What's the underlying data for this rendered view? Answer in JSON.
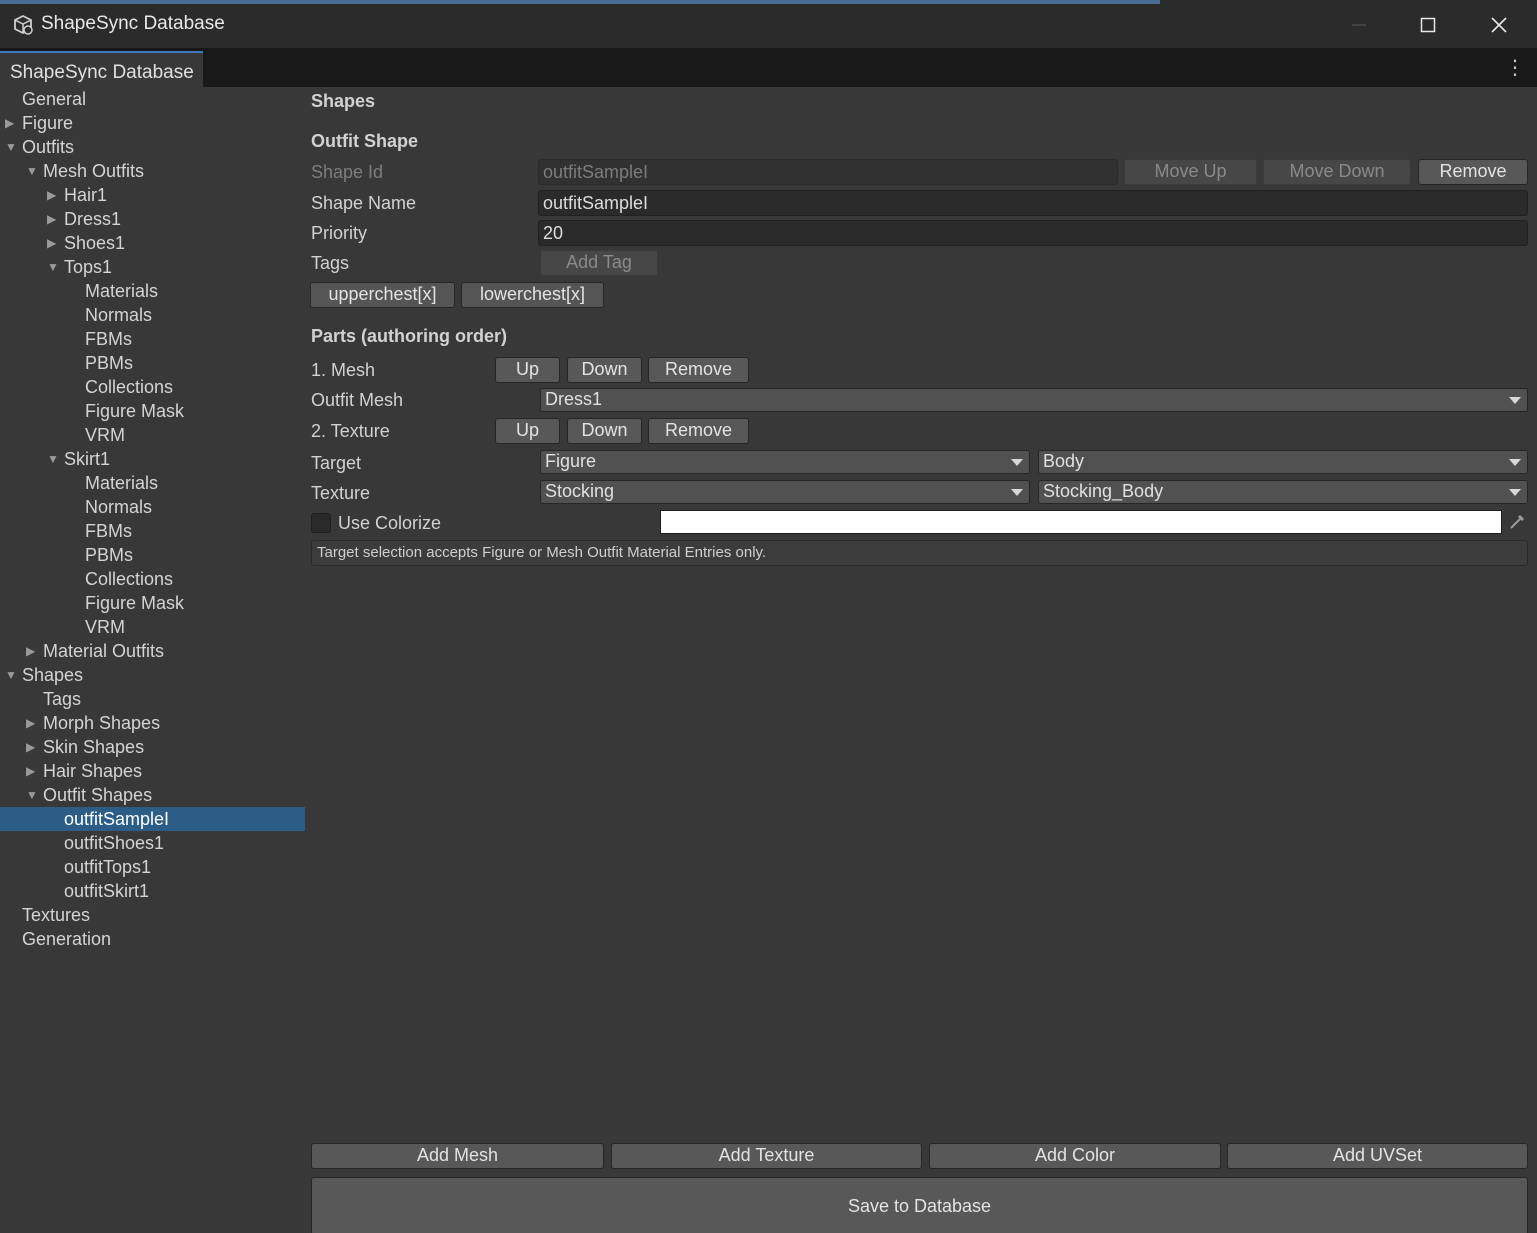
{
  "window": {
    "title": "ShapeSync Database",
    "accent_color": "#3a79bb",
    "selection_color": "#2c5d87"
  },
  "tab": {
    "label": "ShapeSync Database"
  },
  "tree": {
    "items": [
      {
        "label": "General"
      },
      {
        "label": "Figure"
      },
      {
        "label": "Outfits"
      },
      {
        "label": "Mesh Outfits"
      },
      {
        "label": "Hair1"
      },
      {
        "label": "Dress1"
      },
      {
        "label": "Shoes1"
      },
      {
        "label": "Tops1"
      },
      {
        "label": "Materials"
      },
      {
        "label": "Normals"
      },
      {
        "label": "FBMs"
      },
      {
        "label": "PBMs"
      },
      {
        "label": "Collections"
      },
      {
        "label": "Figure Mask"
      },
      {
        "label": "VRM"
      },
      {
        "label": "Skirt1"
      },
      {
        "label": "Materials"
      },
      {
        "label": "Normals"
      },
      {
        "label": "FBMs"
      },
      {
        "label": "PBMs"
      },
      {
        "label": "Collections"
      },
      {
        "label": "Figure Mask"
      },
      {
        "label": "VRM"
      },
      {
        "label": "Material Outfits"
      },
      {
        "label": "Shapes"
      },
      {
        "label": "Tags"
      },
      {
        "label": "Morph Shapes"
      },
      {
        "label": "Skin Shapes"
      },
      {
        "label": "Hair Shapes"
      },
      {
        "label": "Outfit Shapes"
      },
      {
        "label": "outfitSampleI"
      },
      {
        "label": "outfitShoes1"
      },
      {
        "label": "outfitTops1"
      },
      {
        "label": "outfitSkirt1"
      },
      {
        "label": "Textures"
      },
      {
        "label": "Generation"
      }
    ]
  },
  "main": {
    "section_title": "Shapes",
    "subsection_title": "Outfit Shape",
    "shape_id": {
      "label": "Shape Id",
      "value": "outfitSampleI"
    },
    "move_up": "Move Up",
    "move_down": "Move Down",
    "remove": "Remove",
    "shape_name": {
      "label": "Shape Name",
      "value": "outfitSampleI"
    },
    "priority": {
      "label": "Priority",
      "value": "20"
    },
    "tags": {
      "label": "Tags",
      "add_tag": "Add Tag",
      "chips": [
        "upperchest[x]",
        "lowerchest[x]"
      ]
    },
    "parts_title": "Parts (authoring order)",
    "part1": {
      "label": "1. Mesh",
      "up": "Up",
      "down": "Down",
      "remove": "Remove",
      "outfit_mesh_label": "Outfit Mesh",
      "outfit_mesh_value": "Dress1"
    },
    "part2": {
      "label": "2. Texture",
      "up": "Up",
      "down": "Down",
      "remove": "Remove",
      "target_label": "Target",
      "target_value": "Figure",
      "target_sub_value": "Body",
      "texture_label": "Texture",
      "texture_value": "Stocking",
      "texture_sub_value": "Stocking_Body",
      "use_colorize_label": "Use Colorize",
      "use_colorize_checked": false,
      "color_value": "#ffffff",
      "help_text": "Target selection accepts Figure or Mesh Outfit Material Entries only."
    },
    "footer": {
      "add_mesh": "Add Mesh",
      "add_texture": "Add Texture",
      "add_color": "Add Color",
      "add_uvset": "Add UVSet",
      "save": "Save to Database"
    }
  }
}
